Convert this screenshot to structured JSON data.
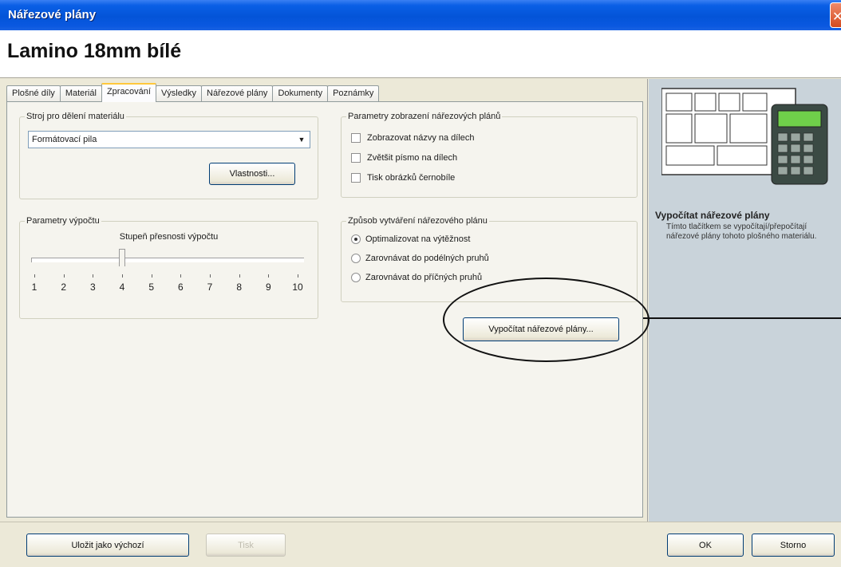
{
  "window": {
    "title": "Nářezové plány"
  },
  "header": {
    "heading": "Lamino 18mm bílé"
  },
  "tabs": [
    {
      "label": "Plošné díly"
    },
    {
      "label": "Materiál"
    },
    {
      "label": "Zpracování",
      "active": true
    },
    {
      "label": "Výsledky"
    },
    {
      "label": "Nářezové plány"
    },
    {
      "label": "Dokumenty"
    },
    {
      "label": "Poznámky"
    }
  ],
  "machine_group": {
    "legend": "Stroj pro dělení materiálu",
    "selected": "Formátovací pila",
    "properties_button": "Vlastnosti..."
  },
  "display_group": {
    "legend": "Parametry zobrazení nářezových plánů",
    "options": [
      {
        "label": "Zobrazovat názvy na dílech",
        "checked": false
      },
      {
        "label": "Zvětšit písmo na dílech",
        "checked": false
      },
      {
        "label": "Tisk obrázků černobíle",
        "checked": false
      }
    ]
  },
  "calc_group": {
    "legend": "Parametry výpočtu",
    "caption": "Stupeň přesnosti výpočtu",
    "ticks": [
      "1",
      "2",
      "3",
      "4",
      "5",
      "6",
      "7",
      "8",
      "9",
      "10"
    ],
    "value": 4
  },
  "method_group": {
    "legend": "Způsob vytváření nářezového plánu",
    "options": [
      {
        "label": "Optimalizovat na výtěžnost",
        "selected": true
      },
      {
        "label": "Zarovnávat do podélných pruhů",
        "selected": false
      },
      {
        "label": "Zarovnávat do příčných pruhů",
        "selected": false
      }
    ]
  },
  "actions": {
    "calculate": "Vypočítat nářezové plány..."
  },
  "side_panel": {
    "title": "Vypočítat nářezové plány",
    "description": "Tímto tlačítkem se vypočítají/přepočítají nářezové plány tohoto plošného materiálu."
  },
  "footer": {
    "save_default": "Uložit jako výchozí",
    "disabled_button": "Tisk",
    "ok": "OK",
    "cancel": "Storno"
  },
  "colors": {
    "titlebar": "#0354d8",
    "side_panel": "#c9d3da",
    "annotation": "#111111"
  }
}
